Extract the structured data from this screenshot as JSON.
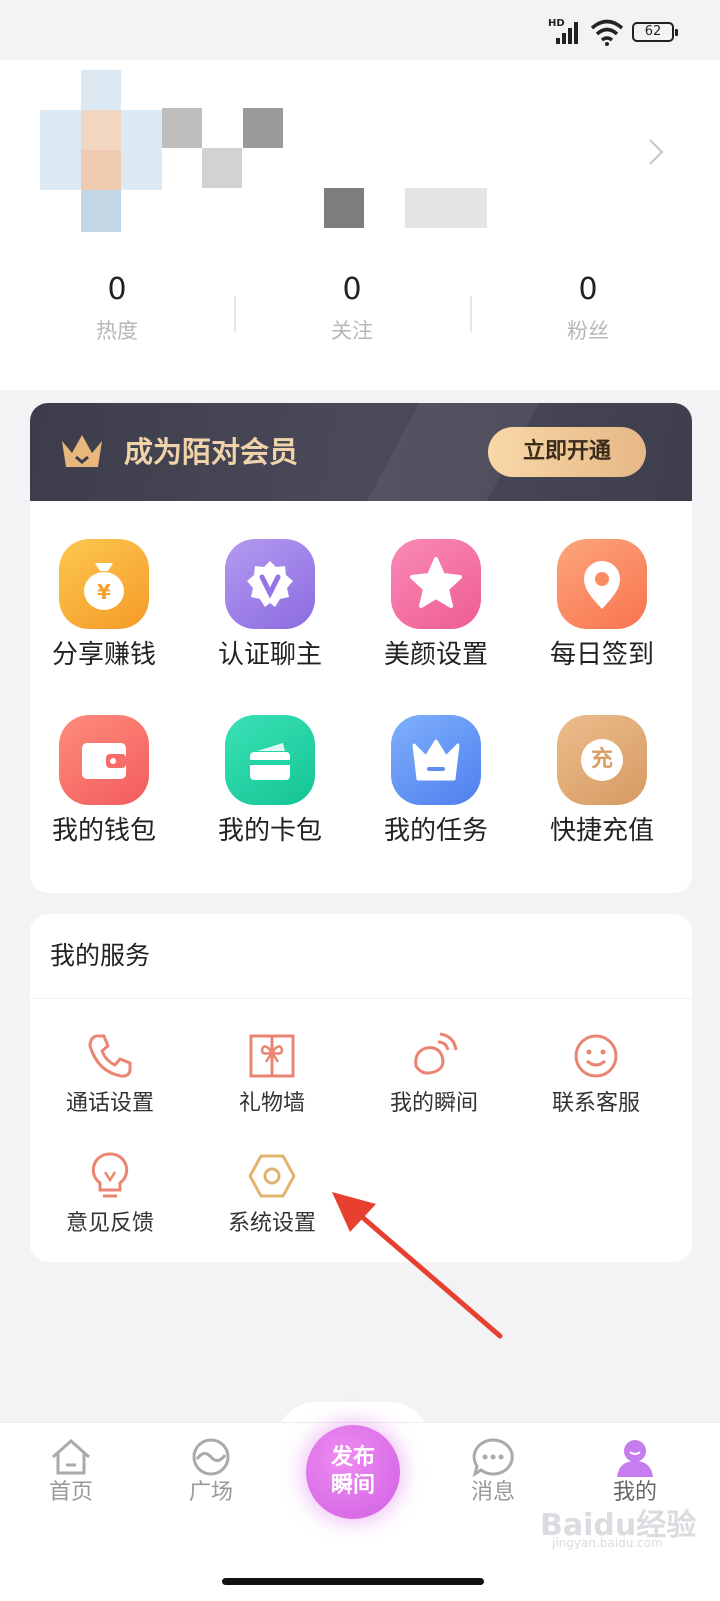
{
  "status_bar": {
    "network": "HD",
    "battery": "62"
  },
  "profile": {
    "stats": [
      {
        "value": "0",
        "label": "热度"
      },
      {
        "value": "0",
        "label": "关注"
      },
      {
        "value": "0",
        "label": "粉丝"
      }
    ]
  },
  "vip": {
    "title": "成为陌对会员",
    "button": "立即开通"
  },
  "features": [
    {
      "label": "分享赚钱",
      "icon": "money-bag-icon",
      "color": "#f7a836"
    },
    {
      "label": "认证聊主",
      "icon": "verified-badge-icon",
      "color": "#9c7ae8"
    },
    {
      "label": "美颜设置",
      "icon": "star-icon",
      "color": "#f46aa2"
    },
    {
      "label": "每日签到",
      "icon": "location-pin-icon",
      "color": "#fb8660"
    },
    {
      "label": "我的钱包",
      "icon": "wallet-icon",
      "color": "#f86c69"
    },
    {
      "label": "我的卡包",
      "icon": "card-icon",
      "color": "#22d3a6"
    },
    {
      "label": "我的任务",
      "icon": "crown-icon",
      "color": "#5d8ff3"
    },
    {
      "label": "快捷充值",
      "icon": "recharge-icon",
      "color": "#dca26b",
      "glyph": "充"
    }
  ],
  "services": {
    "title": "我的服务",
    "items": [
      {
        "label": "通话设置",
        "icon": "phone-icon"
      },
      {
        "label": "礼物墙",
        "icon": "gift-icon"
      },
      {
        "label": "我的瞬间",
        "icon": "moment-icon"
      },
      {
        "label": "联系客服",
        "icon": "smiley-icon"
      },
      {
        "label": "意见反馈",
        "icon": "lightbulb-icon"
      },
      {
        "label": "系统设置",
        "icon": "hex-settings-icon"
      }
    ]
  },
  "tabbar": {
    "tabs": [
      {
        "label": "首页",
        "icon": "home-icon"
      },
      {
        "label": "广场",
        "icon": "plaza-icon"
      },
      {
        "label": "消息",
        "icon": "message-icon"
      },
      {
        "label": "我的",
        "icon": "profile-icon"
      }
    ],
    "publish": {
      "line1": "发布",
      "line2": "瞬间"
    }
  },
  "watermark": {
    "main": "Baidu经验",
    "sub": "jingyan.baidu.com"
  },
  "colors": {
    "accent": "#e9856a",
    "vip_gold": "#f0d3a9",
    "publish": "#d05fe3"
  }
}
